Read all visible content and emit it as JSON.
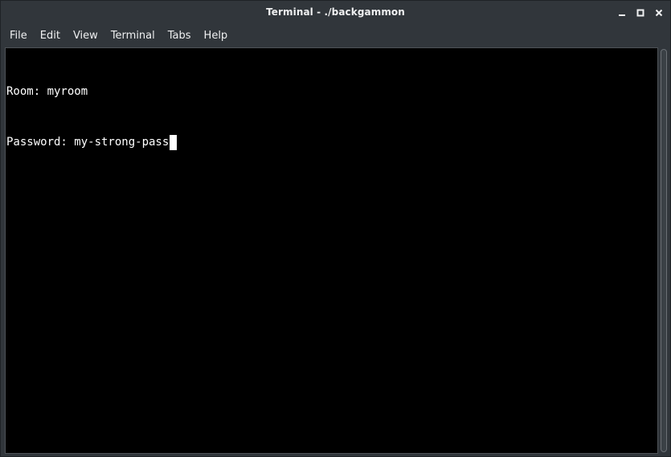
{
  "window": {
    "title": "Terminal - ./backgammon",
    "controls": {
      "minimize_icon": "minimize-icon",
      "maximize_icon": "maximize-icon",
      "close_icon": "close-icon"
    }
  },
  "menubar": {
    "items": [
      {
        "label": "File"
      },
      {
        "label": "Edit"
      },
      {
        "label": "View"
      },
      {
        "label": "Terminal"
      },
      {
        "label": "Tabs"
      },
      {
        "label": "Help"
      }
    ]
  },
  "terminal": {
    "lines": [
      {
        "text": "Room: myroom"
      },
      {
        "text": "Password: my-strong-pass"
      }
    ],
    "colors": {
      "background": "#000000",
      "foreground": "#ffffff"
    }
  }
}
